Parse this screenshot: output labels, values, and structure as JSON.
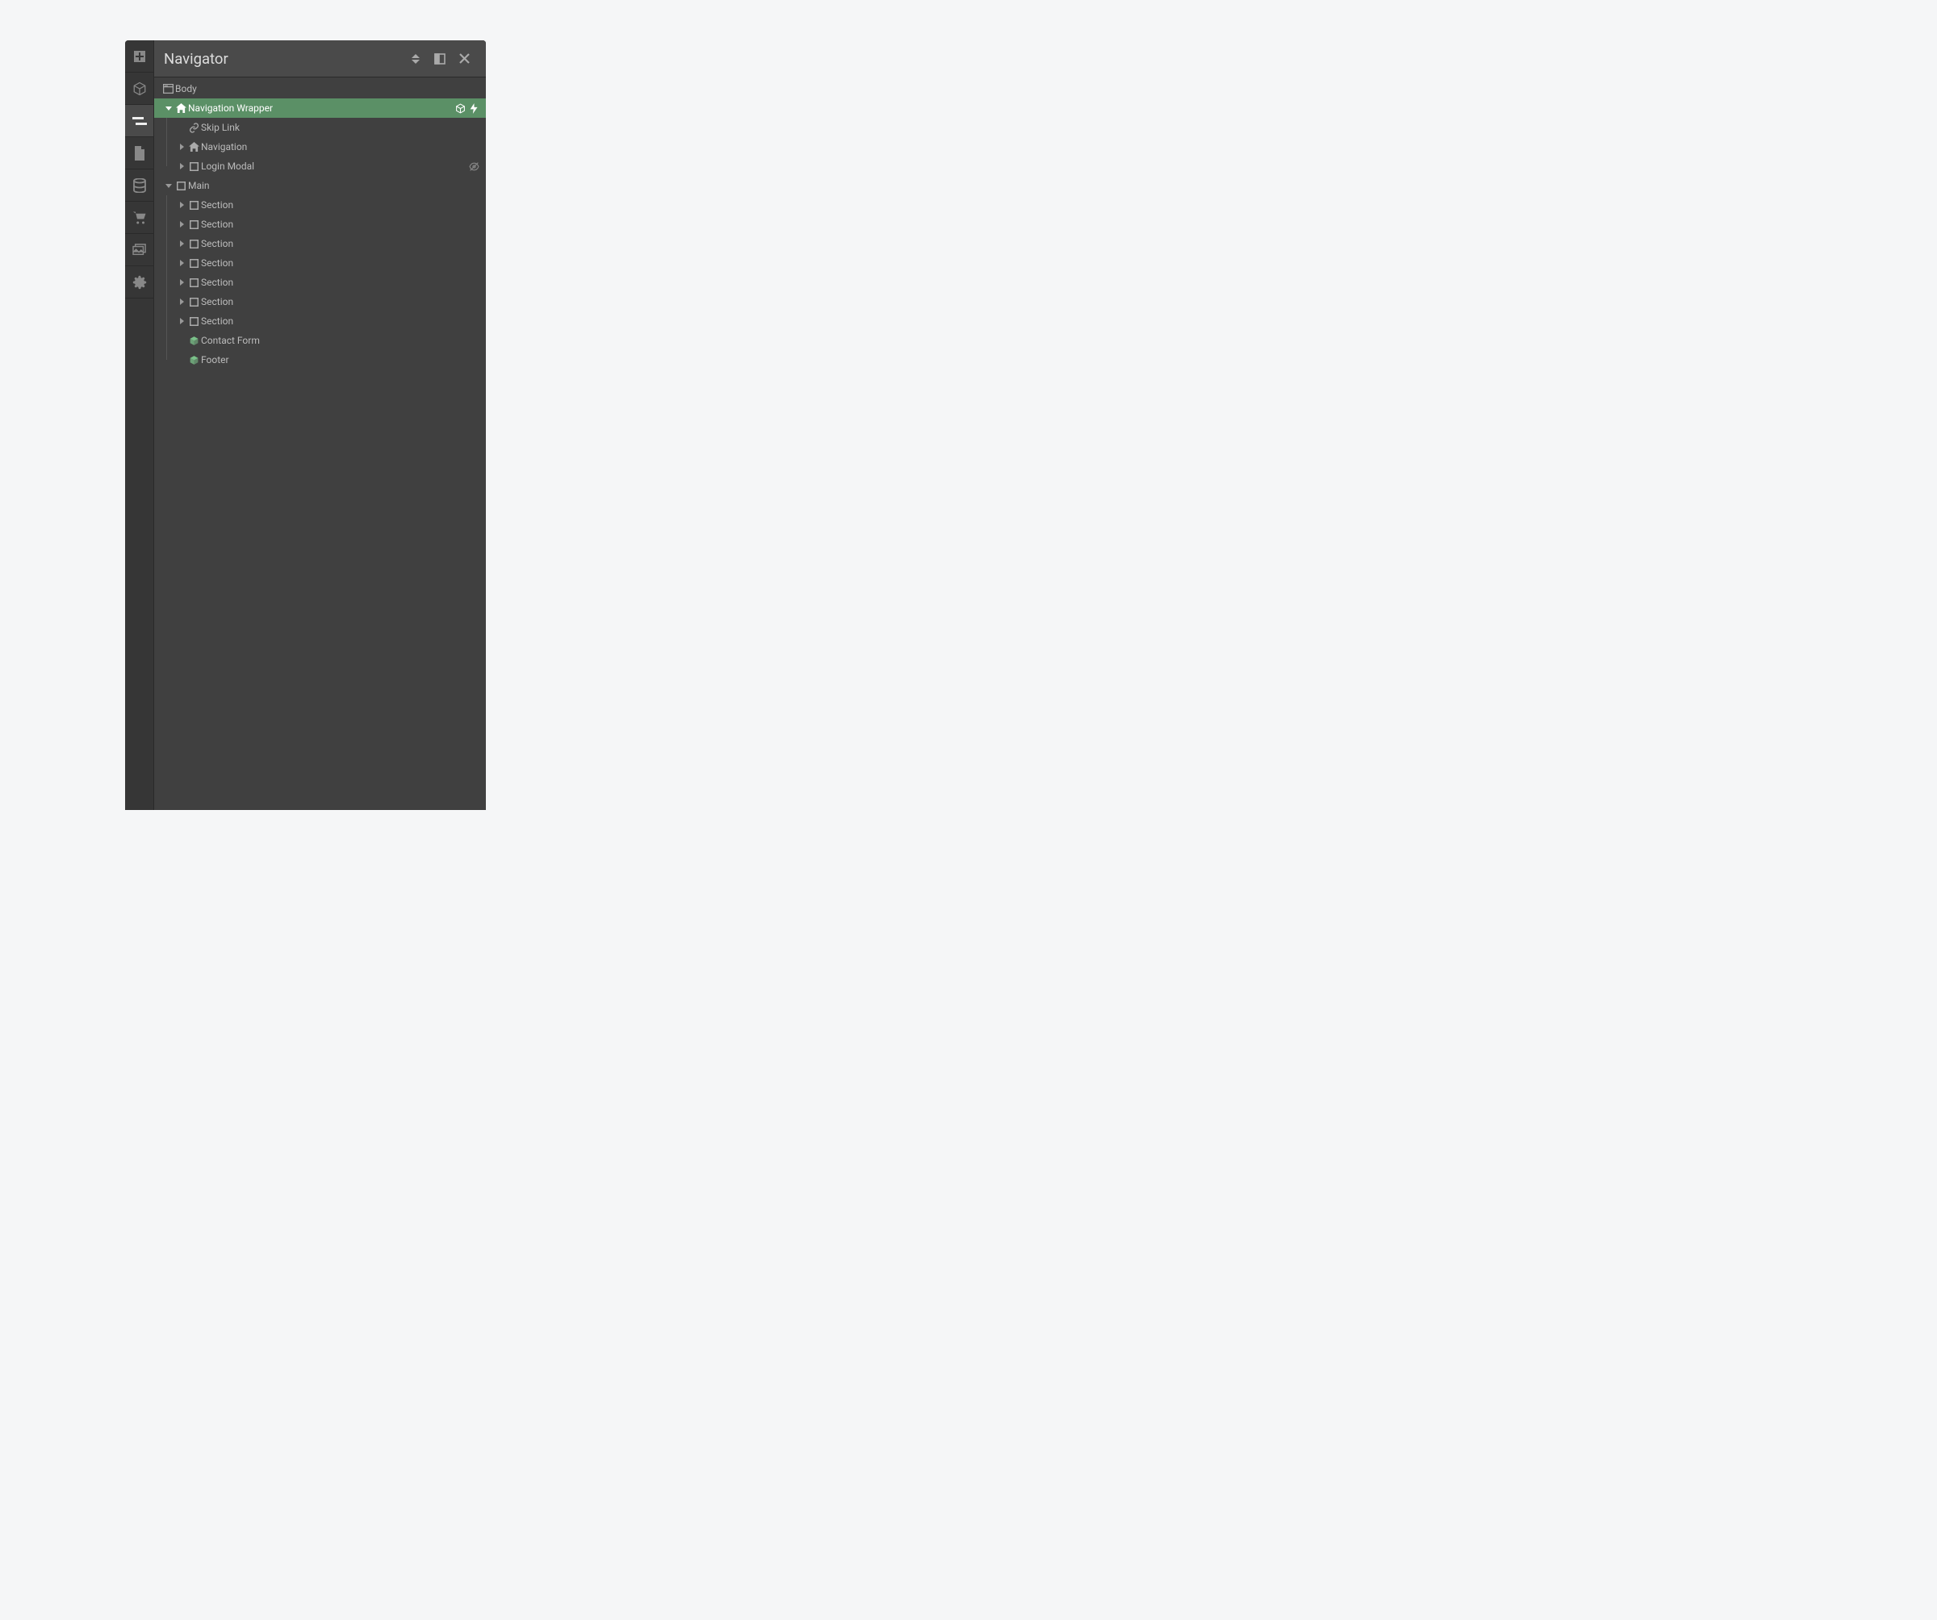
{
  "panel": {
    "title": "Navigator"
  },
  "tree": {
    "body": "Body",
    "nav_wrapper": "Navigation Wrapper",
    "skip_link": "Skip Link",
    "navigation": "Navigation",
    "login_modal": "Login Modal",
    "main": "Main",
    "section1": "Section",
    "section2": "Section",
    "section3": "Section",
    "section4": "Section",
    "section5": "Section",
    "section6": "Section",
    "section7": "Section",
    "contact_form": "Contact Form",
    "footer": "Footer"
  },
  "colors": {
    "selected_bg": "#5b9066",
    "component_green": "#7bc28a"
  }
}
